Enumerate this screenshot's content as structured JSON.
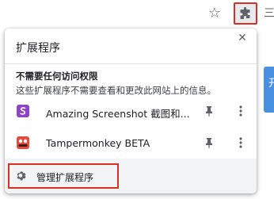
{
  "toolbar": {
    "bookmark_icon": "star-icon",
    "extensions_icon": "puzzle-icon",
    "menu_glyph": "三"
  },
  "page": {
    "partial_button_text": "开"
  },
  "popup": {
    "title": "扩展程序",
    "close_icon": "close-icon",
    "section_heading": "不需要任何访问权限",
    "section_desc": "这些扩展程序不需要查看和更改此网站上的信息。",
    "extensions": [
      {
        "name": "Amazing Screenshot 截图和...",
        "icon": "screenshot-extension-icon",
        "icon_color": "#8e44c9"
      },
      {
        "name": "Tampermonkey BETA",
        "icon": "tampermonkey-icon",
        "icon_color": "#e64a3c"
      }
    ],
    "manage_label": "管理扩展程序"
  },
  "colors": {
    "highlight": "#d93025",
    "footer_bg": "#f1f3f4",
    "accent_blue": "#4a90e2"
  }
}
